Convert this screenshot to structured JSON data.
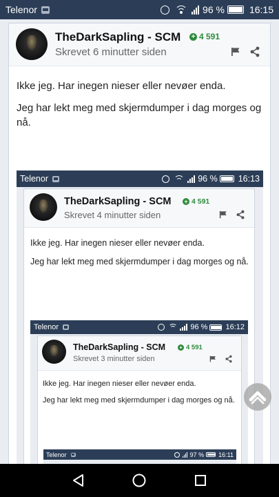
{
  "status_bar": {
    "carrier": "Telenor",
    "battery": "96 %",
    "time": "16:15"
  },
  "post": {
    "username": "TheDarkSapling - SCM",
    "reputation": "4 591",
    "timestamp": "Skrevet 6 minutter siden",
    "paragraphs": [
      "Ikke jeg. Har inegen nieser eller nevøer enda.",
      "Jeg har lekt meg med skjermdumper i dag morges og nå."
    ]
  },
  "screenshot_1": {
    "status_bar": {
      "carrier": "Telenor",
      "battery": "96 %",
      "time": "16:13"
    },
    "username": "TheDarkSapling - SCM",
    "reputation": "4 591",
    "timestamp": "Skrevet 4 minutter siden",
    "paragraphs": [
      "Ikke jeg. Har inegen nieser eller nevøer enda.",
      "Jeg har lekt meg med skjermdumper i dag morges og nå."
    ]
  },
  "screenshot_2": {
    "status_bar": {
      "carrier": "Telenor",
      "battery": "96 %",
      "time": "16:12"
    },
    "username": "TheDarkSapling - SCM",
    "reputation": "4 591",
    "timestamp": "Skrevet 3 minutter siden",
    "paragraphs": [
      "Ikke jeg. Har inegen nieser eller nevøer enda.",
      "Jeg har lekt meg med skjermdumper i dag morges og nå."
    ]
  },
  "screenshot_3": {
    "status_bar": {
      "carrier": "Telenor",
      "battery": "97 %",
      "time": "16:11"
    }
  },
  "icons": {
    "flag": "flag-icon",
    "share": "share-icon",
    "scroll_top": "chevron-up-icon",
    "nav_back": "triangle-back-icon",
    "nav_home": "circle-home-icon",
    "nav_recents": "square-recents-icon"
  },
  "colors": {
    "status_bar": "#2c3e57",
    "reputation_green": "#2e8b3c",
    "card_border": "#cdd4dd"
  }
}
